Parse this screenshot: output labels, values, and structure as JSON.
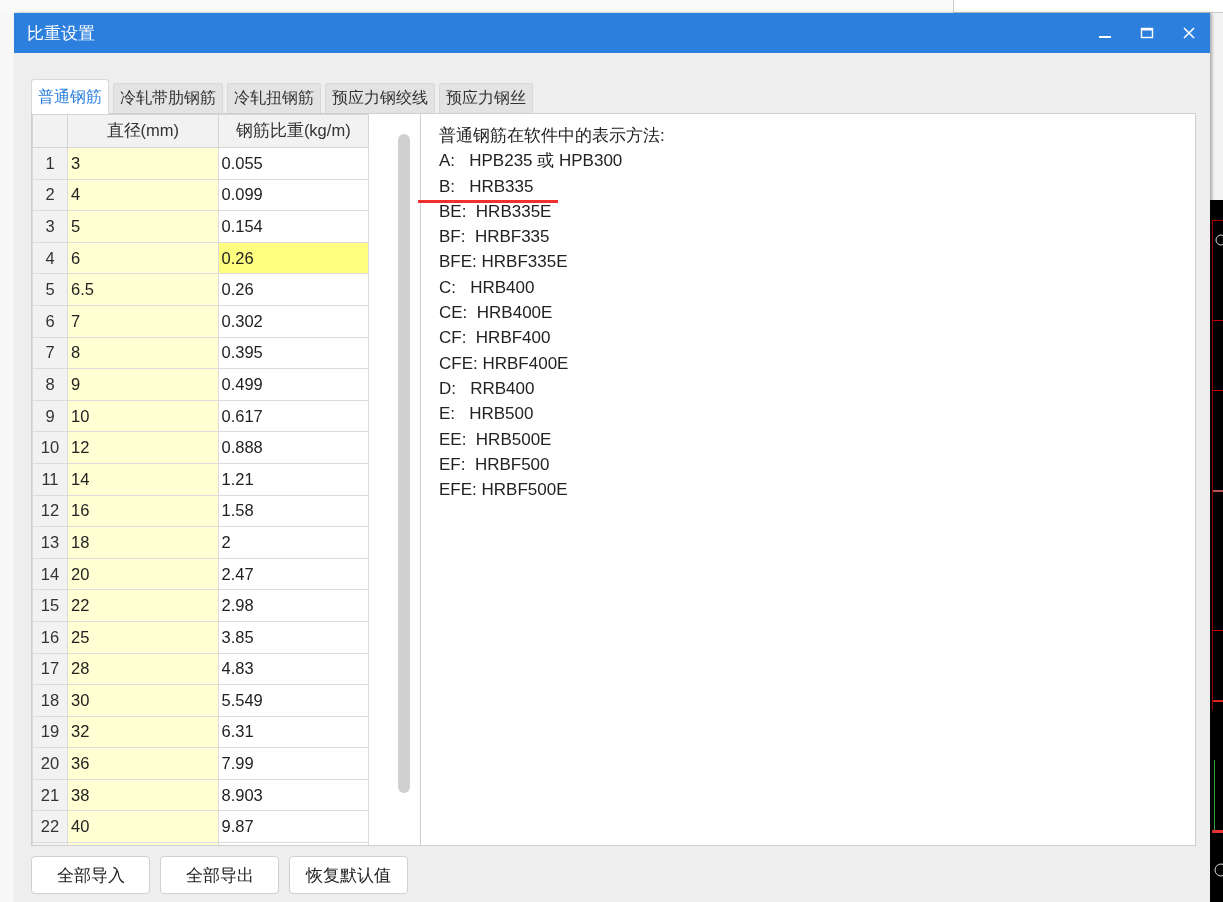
{
  "dialog": {
    "title": "比重设置"
  },
  "tabs": [
    {
      "label": "普通钢筋",
      "selected": true
    },
    {
      "label": "冷轧带肋钢筋",
      "selected": false
    },
    {
      "label": "冷轧扭钢筋",
      "selected": false
    },
    {
      "label": "预应力钢绞线",
      "selected": false
    },
    {
      "label": "预应力钢丝",
      "selected": false
    }
  ],
  "table": {
    "columns": [
      "直径(mm)",
      "钢筋比重(kg/m)"
    ],
    "rows": [
      {
        "index": "1",
        "diameter": "3",
        "weight": "0.055",
        "selected": false
      },
      {
        "index": "2",
        "diameter": "4",
        "weight": "0.099",
        "selected": false
      },
      {
        "index": "3",
        "diameter": "5",
        "weight": "0.154",
        "selected": false
      },
      {
        "index": "4",
        "diameter": "6",
        "weight": "0.26",
        "selected": true
      },
      {
        "index": "5",
        "diameter": "6.5",
        "weight": "0.26",
        "selected": false
      },
      {
        "index": "6",
        "diameter": "7",
        "weight": "0.302",
        "selected": false
      },
      {
        "index": "7",
        "diameter": "8",
        "weight": "0.395",
        "selected": false
      },
      {
        "index": "8",
        "diameter": "9",
        "weight": "0.499",
        "selected": false
      },
      {
        "index": "9",
        "diameter": "10",
        "weight": "0.617",
        "selected": false
      },
      {
        "index": "10",
        "diameter": "12",
        "weight": "0.888",
        "selected": false
      },
      {
        "index": "11",
        "diameter": "14",
        "weight": "1.21",
        "selected": false
      },
      {
        "index": "12",
        "diameter": "16",
        "weight": "1.58",
        "selected": false
      },
      {
        "index": "13",
        "diameter": "18",
        "weight": "2",
        "selected": false
      },
      {
        "index": "14",
        "diameter": "20",
        "weight": "2.47",
        "selected": false
      },
      {
        "index": "15",
        "diameter": "22",
        "weight": "2.98",
        "selected": false
      },
      {
        "index": "16",
        "diameter": "25",
        "weight": "3.85",
        "selected": false
      },
      {
        "index": "17",
        "diameter": "28",
        "weight": "4.83",
        "selected": false
      },
      {
        "index": "18",
        "diameter": "30",
        "weight": "5.549",
        "selected": false
      },
      {
        "index": "19",
        "diameter": "32",
        "weight": "6.31",
        "selected": false
      },
      {
        "index": "20",
        "diameter": "36",
        "weight": "7.99",
        "selected": false
      },
      {
        "index": "21",
        "diameter": "38",
        "weight": "8.903",
        "selected": false
      },
      {
        "index": "22",
        "diameter": "40",
        "weight": "9.87",
        "selected": false
      }
    ]
  },
  "notation": {
    "heading": "普通钢筋在软件中的表示方法:",
    "lines": [
      {
        "text": "A:   HPB235 或 HPB300",
        "marked": false
      },
      {
        "text": "B:   HRB335",
        "marked": true
      },
      {
        "text": "BE:  HRB335E",
        "marked": false
      },
      {
        "text": "BF:  HRBF335",
        "marked": false
      },
      {
        "text": "BFE: HRBF335E",
        "marked": false
      },
      {
        "text": "C:   HRB400",
        "marked": false
      },
      {
        "text": "CE:  HRB400E",
        "marked": false
      },
      {
        "text": "CF:  HRBF400",
        "marked": false
      },
      {
        "text": "CFE: HRBF400E",
        "marked": false
      },
      {
        "text": "D:   RRB400",
        "marked": false
      },
      {
        "text": "E:   HRB500",
        "marked": false
      },
      {
        "text": "EE:  HRB500E",
        "marked": false
      },
      {
        "text": "EF:  HRBF500",
        "marked": false
      },
      {
        "text": "EFE: HRBF500E",
        "marked": false
      }
    ]
  },
  "buttons": [
    "全部导入",
    "全部导出",
    "恢复默认值"
  ]
}
